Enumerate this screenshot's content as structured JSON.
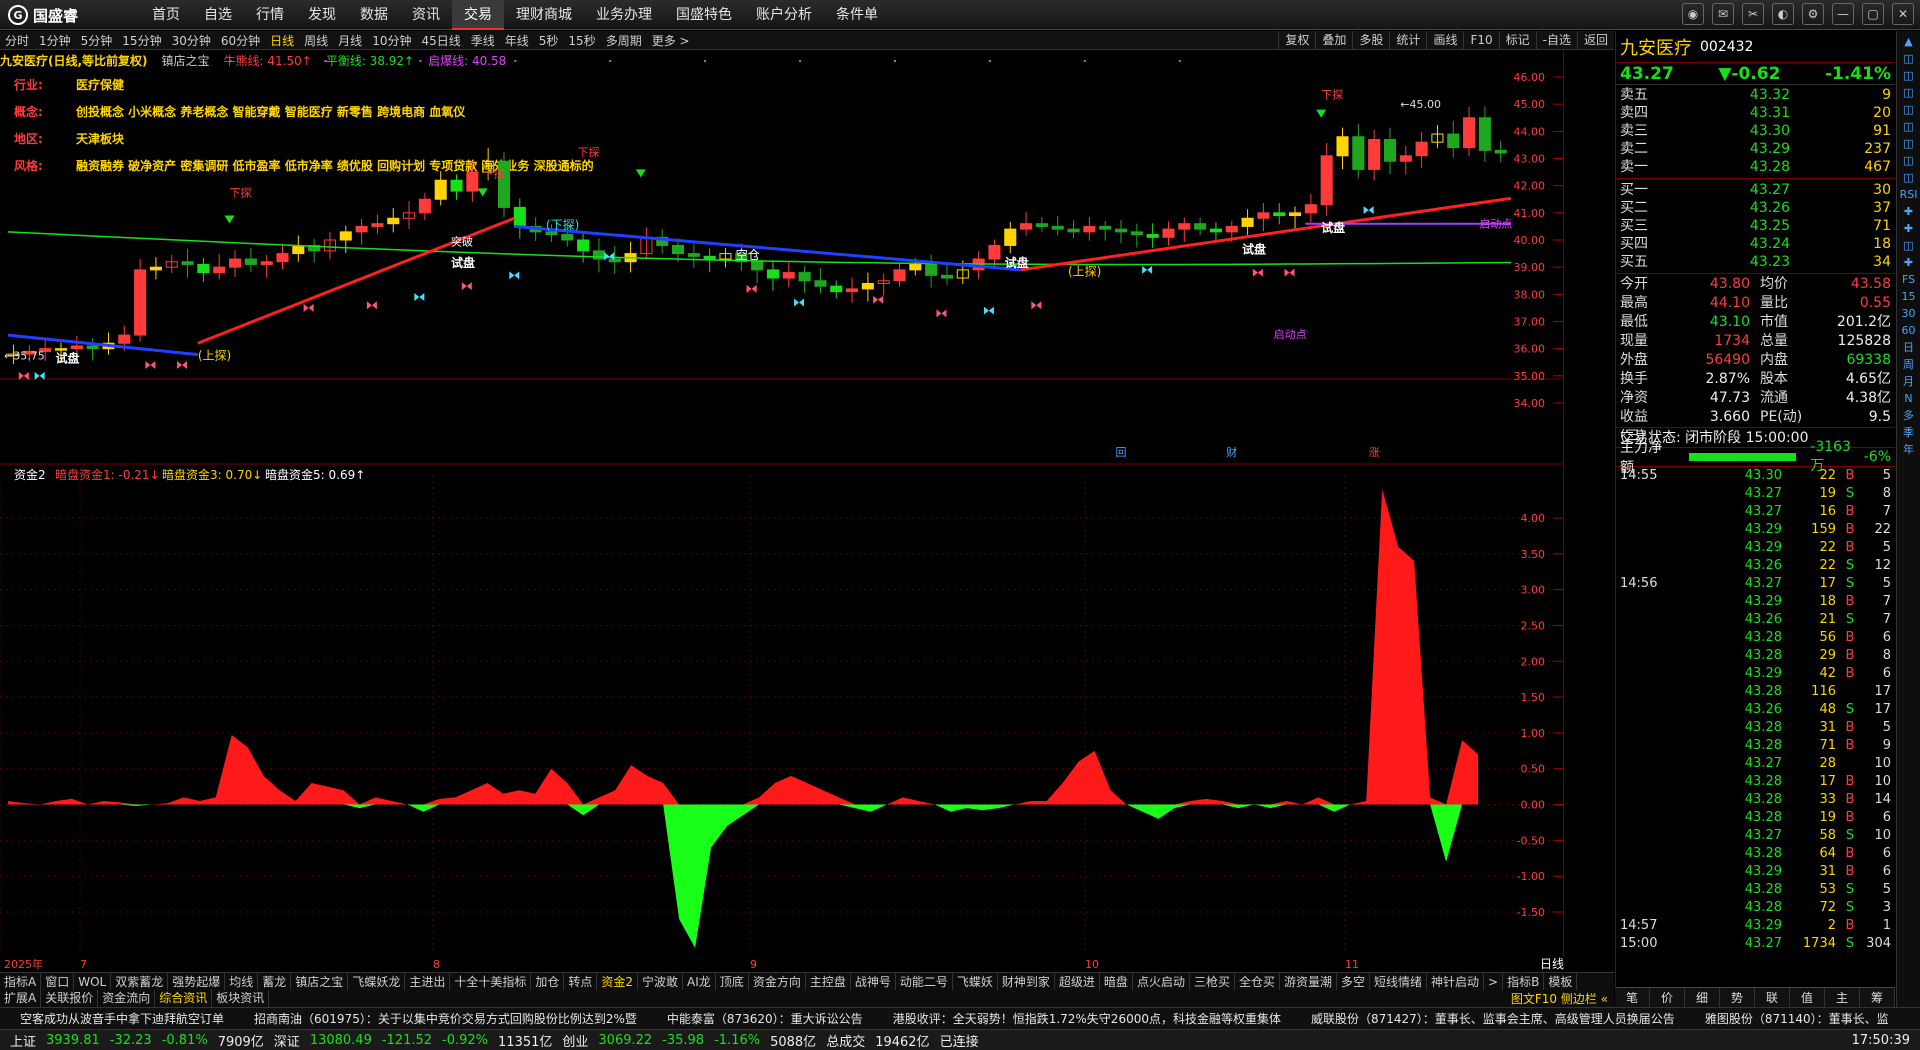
{
  "brand": "国盛睿",
  "menu": [
    "首页",
    "自选",
    "行情",
    "发现",
    "数据",
    "资讯",
    "交易",
    "理财商城",
    "业务办理",
    "国盛特色",
    "账户分析",
    "条件单"
  ],
  "menu_active": 6,
  "periods": [
    "分时",
    "1分钟",
    "5分钟",
    "15分钟",
    "30分钟",
    "60分钟",
    "日线",
    "周线",
    "月线",
    "10分钟",
    "45日线",
    "季线",
    "年线",
    "5秒",
    "15秒",
    "多周期",
    "更多 >"
  ],
  "period_active": 6,
  "tools_right": [
    "复权",
    "叠加",
    "多股",
    "统计",
    "画线",
    "F10",
    "标记",
    "-自选",
    "返回"
  ],
  "chart_header": {
    "stock": "九安医疗(日线,等比前复权)",
    "indicator": "镇店之宝",
    "line1_label": "牛熊线: 41.50↑",
    "line2_label": "平衡线: 38.92↑",
    "line3_label": "启爆线: 40.58"
  },
  "info": [
    {
      "k": "行业:",
      "v": "医疗保健"
    },
    {
      "k": "概念:",
      "v": "创投概念 小米概念 养老概念 智能穿戴 智能医疗 新零售 跨境电商 血氧仪"
    },
    {
      "k": "地区:",
      "v": "天津板块"
    },
    {
      "k": "风格:",
      "v": "融资融券 破净资产 密集调研 低市盈率 低市净率 绩优股 回购计划 专项贷款 海外业务 深股通标的"
    }
  ],
  "price_axis": [
    "46.00",
    "45.00",
    "44.00",
    "43.00",
    "42.00",
    "41.00",
    "40.00",
    "39.00",
    "38.00",
    "37.00",
    "36.00",
    "35.00",
    "34.00"
  ],
  "price_min": 34,
  "price_max": 46,
  "annotations": {
    "hi": "45.00",
    "lo": "35.75",
    "qidong": "启动点",
    "kongcang": "空仓",
    "xiatan": "(下探)",
    "shangtan": "(上探)",
    "shipan": "试盘",
    "tupo": "突破",
    "xiatan2": "下探"
  },
  "bottom_marks": [
    "回",
    "财",
    "涨"
  ],
  "sub_header": {
    "name": "资金2",
    "v1": "暗盘资金1: -0.21↓",
    "v3": "暗盘资金3: 0.70↓",
    "v5": "暗盘资金5: 0.69↑"
  },
  "sub_axis": [
    "4.00",
    "3.50",
    "3.00",
    "2.50",
    "2.00",
    "1.50",
    "1.00",
    "0.50",
    "0.00",
    "-0.50",
    "-1.00",
    "-1.50"
  ],
  "date_labels": [
    "2025年",
    "7",
    "8",
    "9",
    "10",
    "11"
  ],
  "date_corner": "日线",
  "ind_tabs": [
    "指标A",
    "窗口",
    "WOL",
    "双紫蓄龙",
    "强势起爆",
    "均线",
    "蓄龙",
    "镇店之宝",
    "飞蝶妖龙",
    "主进出",
    "十全十美指标",
    "加仓",
    "转点",
    "资金2",
    "宁波敢",
    "AI龙",
    "顶底",
    "资金方向",
    "主控盘",
    "战神号",
    "动能二号",
    "飞蝶妖",
    "财神到家",
    "超级进",
    "暗盘",
    "点火启动",
    "三枪买",
    "全仓买",
    "游资量潮",
    "多空",
    "短线情绪",
    "神针启动",
    ">",
    "指标B",
    "模板"
  ],
  "ind_tab_active": 13,
  "ext_tabs": [
    "扩展A",
    "关联报价",
    "资金流向",
    "综合资讯",
    "板块资讯"
  ],
  "ext_tab_active": 3,
  "ext_right": "图文F10 侧边栏 «",
  "news": [
    "空客成功从波音手中拿下迪拜航空订单",
    "招商南油（601975）：关于以集中竞价交易方式回购股份比例达到2%暨",
    "中能泰富（873620）：重大诉讼公告",
    "港股收评：全天弱势！恒指跌1.72%失守26000点，科技金融等权重集体",
    "威联股份（871427）：董事长、监事会主席、高级管理人员换届公告",
    "雅图股份（871140）：董事长、监"
  ],
  "status": {
    "sh_name": "上证",
    "sh_val": "3939.81",
    "sh_chg": "-32.23",
    "sh_pct": "-0.81%",
    "sh_amt": "7909亿",
    "sz_name": "深证",
    "sz_val": "13080.49",
    "sz_chg": "-121.52",
    "sz_pct": "-0.92%",
    "sz_amt": "11351亿",
    "cy_name": "创业",
    "cy_val": "3069.22",
    "cy_chg": "-35.98",
    "cy_pct": "-1.16%",
    "cy_amt": "5088亿",
    "total_label": "总成交",
    "total": "19462亿",
    "conn": "已连接",
    "time": "17:50:39"
  },
  "quote": {
    "name": "九安医疗",
    "code": "002432",
    "price": "43.27",
    "chg": "▼-0.62",
    "pct": "-1.41%",
    "asks": [
      {
        "l": "卖五",
        "p": "43.32",
        "v": "9"
      },
      {
        "l": "卖四",
        "p": "43.31",
        "v": "20"
      },
      {
        "l": "卖三",
        "p": "43.30",
        "v": "91"
      },
      {
        "l": "卖二",
        "p": "43.29",
        "v": "237"
      },
      {
        "l": "卖一",
        "p": "43.28",
        "v": "467"
      }
    ],
    "bids": [
      {
        "l": "买一",
        "p": "43.27",
        "v": "30"
      },
      {
        "l": "买二",
        "p": "43.26",
        "v": "37"
      },
      {
        "l": "买三",
        "p": "43.25",
        "v": "71"
      },
      {
        "l": "买四",
        "p": "43.24",
        "v": "18"
      },
      {
        "l": "买五",
        "p": "43.23",
        "v": "34"
      }
    ],
    "stats": [
      {
        "k": "今开",
        "v": "43.80",
        "vc": "red",
        "k2": "均价",
        "v2": "43.58",
        "v2c": "red"
      },
      {
        "k": "最高",
        "v": "44.10",
        "vc": "red",
        "k2": "量比",
        "v2": "0.55",
        "v2c": "red"
      },
      {
        "k": "最低",
        "v": "43.10",
        "vc": "green",
        "k2": "市值",
        "v2": "201.2亿",
        "v2c": "white"
      },
      {
        "k": "现量",
        "v": "1734",
        "vc": "red",
        "k2": "总量",
        "v2": "125828",
        "v2c": "white"
      },
      {
        "k": "外盘",
        "v": "56490",
        "vc": "red",
        "k2": "内盘",
        "v2": "69338",
        "v2c": "green"
      },
      {
        "k": "换手",
        "v": "2.87%",
        "vc": "white",
        "k2": "股本",
        "v2": "4.65亿",
        "v2c": "white"
      },
      {
        "k": "净资",
        "v": "47.73",
        "vc": "white",
        "k2": "流通",
        "v2": "4.38亿",
        "v2c": "white"
      },
      {
        "k": "收益(三)",
        "v": "3.660",
        "vc": "white",
        "k2": "PE(动)",
        "v2": "9.5",
        "v2c": "white"
      }
    ],
    "trade_state": "交易状态: 闭市阶段 15:00:00",
    "flow_label": "主力净额",
    "flow_val": "-3163万",
    "flow_pct": "-6%",
    "ticks": [
      {
        "t": "14:55",
        "p": "43.30",
        "v": "22",
        "d": "B",
        "n": "5"
      },
      {
        "t": "",
        "p": "43.27",
        "v": "19",
        "d": "S",
        "n": "8"
      },
      {
        "t": "",
        "p": "43.27",
        "v": "16",
        "d": "B",
        "n": "7"
      },
      {
        "t": "",
        "p": "43.29",
        "v": "159",
        "d": "B",
        "n": "22"
      },
      {
        "t": "",
        "p": "43.29",
        "v": "22",
        "d": "B",
        "n": "5"
      },
      {
        "t": "",
        "p": "43.26",
        "v": "22",
        "d": "S",
        "n": "12"
      },
      {
        "t": "14:56",
        "p": "43.27",
        "v": "17",
        "d": "S",
        "n": "5"
      },
      {
        "t": "",
        "p": "43.29",
        "v": "18",
        "d": "B",
        "n": "7"
      },
      {
        "t": "",
        "p": "43.26",
        "v": "21",
        "d": "S",
        "n": "7"
      },
      {
        "t": "",
        "p": "43.28",
        "v": "56",
        "d": "B",
        "n": "6"
      },
      {
        "t": "",
        "p": "43.28",
        "v": "29",
        "d": "B",
        "n": "8"
      },
      {
        "t": "",
        "p": "43.29",
        "v": "42",
        "d": "B",
        "n": "6"
      },
      {
        "t": "",
        "p": "43.28",
        "v": "116",
        "d": "",
        "n": "17"
      },
      {
        "t": "",
        "p": "43.26",
        "v": "48",
        "d": "S",
        "n": "17"
      },
      {
        "t": "",
        "p": "43.28",
        "v": "31",
        "d": "B",
        "n": "5"
      },
      {
        "t": "",
        "p": "43.28",
        "v": "71",
        "d": "B",
        "n": "9"
      },
      {
        "t": "",
        "p": "43.27",
        "v": "28",
        "d": "",
        "n": "10"
      },
      {
        "t": "",
        "p": "43.28",
        "v": "17",
        "d": "B",
        "n": "10"
      },
      {
        "t": "",
        "p": "43.28",
        "v": "33",
        "d": "B",
        "n": "14"
      },
      {
        "t": "",
        "p": "43.28",
        "v": "19",
        "d": "B",
        "n": "6"
      },
      {
        "t": "",
        "p": "43.27",
        "v": "58",
        "d": "S",
        "n": "10"
      },
      {
        "t": "",
        "p": "43.28",
        "v": "64",
        "d": "B",
        "n": "6"
      },
      {
        "t": "",
        "p": "43.29",
        "v": "31",
        "d": "B",
        "n": "6"
      },
      {
        "t": "",
        "p": "43.28",
        "v": "53",
        "d": "S",
        "n": "5"
      },
      {
        "t": "",
        "p": "43.28",
        "v": "72",
        "d": "S",
        "n": "3"
      },
      {
        "t": "14:57",
        "p": "43.29",
        "v": "2",
        "d": "B",
        "n": "1"
      },
      {
        "t": "15:00",
        "p": "43.27",
        "v": "1734",
        "d": "S",
        "n": "304"
      }
    ],
    "tabs": [
      "笔",
      "价",
      "细",
      "势",
      "联",
      "值",
      "主",
      "筹"
    ]
  },
  "sidebar": [
    "▲",
    "◫",
    "◫",
    "◫",
    "◫",
    "◫",
    "◫",
    "◫",
    "◫",
    "RSI",
    "✚",
    "✚",
    "◫",
    "✚",
    "FS",
    "15",
    "30",
    "60",
    "日",
    "周",
    "月",
    "N",
    "多",
    "季",
    "年"
  ]
}
